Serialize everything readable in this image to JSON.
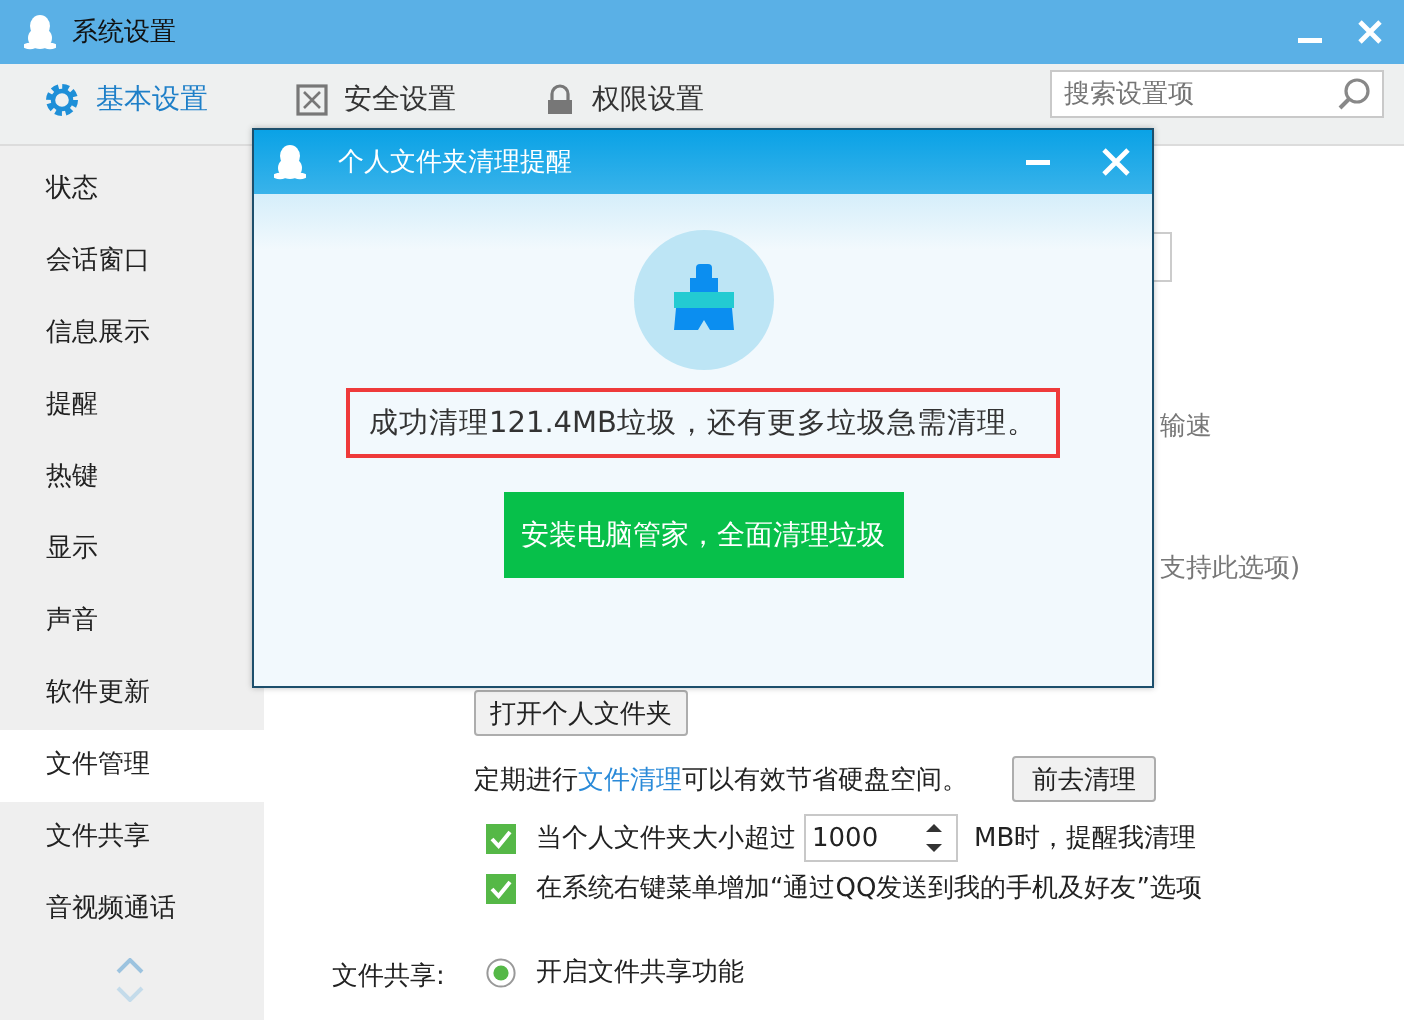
{
  "window": {
    "title": "系统设置"
  },
  "tabs": [
    {
      "label": "基本设置",
      "selected": true
    },
    {
      "label": "安全设置",
      "selected": false
    },
    {
      "label": "权限设置",
      "selected": false
    }
  ],
  "search": {
    "placeholder": "搜索设置项"
  },
  "sidebar": {
    "items": [
      {
        "label": "状态",
        "selected": false
      },
      {
        "label": "会话窗口",
        "selected": false
      },
      {
        "label": "信息展示",
        "selected": false
      },
      {
        "label": "提醒",
        "selected": false
      },
      {
        "label": "热键",
        "selected": false
      },
      {
        "label": "显示",
        "selected": false
      },
      {
        "label": "声音",
        "selected": false
      },
      {
        "label": "软件更新",
        "selected": false
      },
      {
        "label": "文件管理",
        "selected": true
      },
      {
        "label": "文件共享",
        "selected": false
      },
      {
        "label": "音视频通话",
        "selected": false
      }
    ]
  },
  "content": {
    "clipped_texts": [
      "输速",
      "支持此选项)"
    ],
    "open_folder_button": "打开个人文件夹",
    "cleanup": {
      "before": "定期进行",
      "link": "文件清理",
      "after": "可以有效节省硬盘空间。",
      "button": "前去清理"
    },
    "options": [
      {
        "kind": "spin",
        "checked": true,
        "before": "当个人文件夹大小超过",
        "value": "1000",
        "after": "MB时，提醒我清理"
      },
      {
        "kind": "plain",
        "checked": true,
        "label": "在系统右键菜单增加“通过QQ发送到我的手机及好友”选项"
      }
    ],
    "file_share": {
      "label": "文件共享:",
      "options": [
        {
          "label": "开启文件共享功能",
          "selected": true
        }
      ]
    }
  },
  "dialog": {
    "title": "个人文件夹清理提醒",
    "message": "成功清理121.4MB垃圾，还有更多垃圾急需清理。",
    "action_button": "安装电脑管家，全面清理垃圾"
  }
}
